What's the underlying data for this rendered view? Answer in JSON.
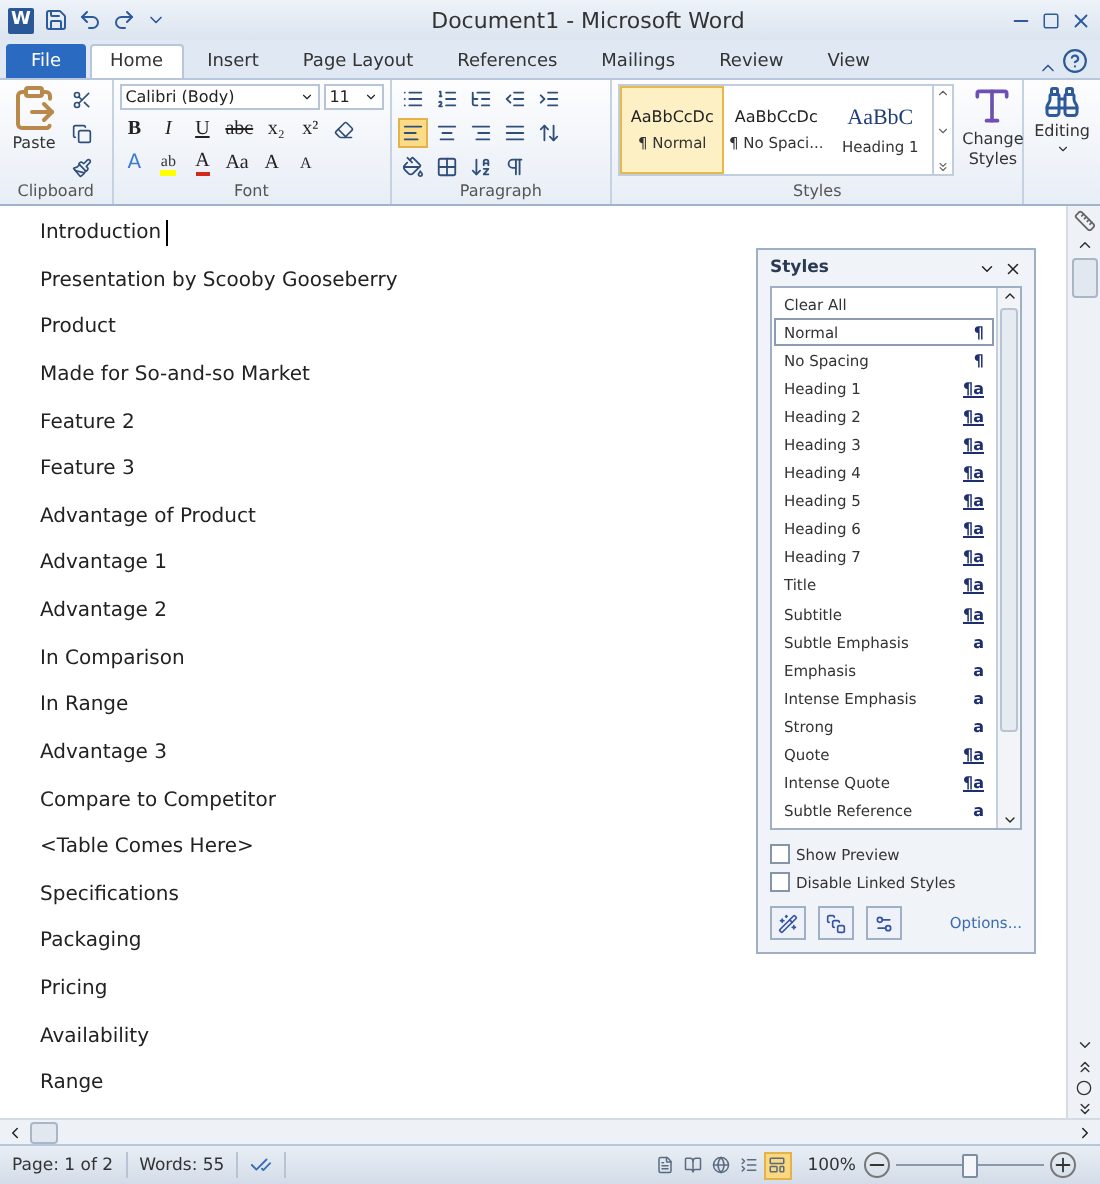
{
  "window": {
    "app_letter": "W",
    "title": "Document1 - Microsoft Word"
  },
  "tabs": [
    {
      "label": "File",
      "kind": "file",
      "selected": false
    },
    {
      "label": "Home",
      "kind": "tab",
      "selected": true
    },
    {
      "label": "Insert",
      "kind": "tab",
      "selected": false
    },
    {
      "label": "Page Layout",
      "kind": "tab",
      "selected": false
    },
    {
      "label": "References",
      "kind": "tab",
      "selected": false
    },
    {
      "label": "Mailings",
      "kind": "tab",
      "selected": false
    },
    {
      "label": "Review",
      "kind": "tab",
      "selected": false
    },
    {
      "label": "View",
      "kind": "tab",
      "selected": false
    }
  ],
  "ribbon": {
    "clipboard": {
      "paste_label": "Paste",
      "group_label": "Clipboard"
    },
    "font": {
      "font_name": "Calibri (Body)",
      "font_size": "11",
      "group_label": "Font",
      "row1": [
        "B",
        "I",
        "U",
        "abc",
        "x₂",
        "x²"
      ],
      "row2": [
        {
          "text": "A",
          "kind": "effects"
        },
        {
          "text": "ab",
          "kind": "highlight"
        },
        {
          "text": "A",
          "kind": "color"
        },
        {
          "text": "Aa",
          "kind": "case"
        },
        {
          "text": "A",
          "kind": "grow"
        },
        {
          "text": "A",
          "kind": "shrink"
        }
      ]
    },
    "paragraph": {
      "group_label": "Paragraph",
      "alignments": [
        {
          "kind": "left",
          "selected": true
        },
        {
          "kind": "center",
          "selected": false
        },
        {
          "kind": "right",
          "selected": false
        },
        {
          "kind": "justify",
          "selected": false
        }
      ]
    },
    "styles": {
      "group_label": "Styles",
      "gallery": [
        {
          "preview": "AaBbCcDc",
          "label": "¶ Normal",
          "kind": "body",
          "selected": true
        },
        {
          "preview": "AaBbCcDc",
          "label": "¶ No Spaci...",
          "kind": "body",
          "selected": false
        },
        {
          "preview": "AaBbC",
          "label": "Heading 1",
          "kind": "heading",
          "selected": false
        }
      ],
      "change_styles": [
        "Change",
        "Styles"
      ]
    },
    "editing": {
      "label": "Editing"
    }
  },
  "document": {
    "lines": [
      {
        "text": "Introduction",
        "cursor": true
      },
      {
        "text": "Presentation by Scooby Gooseberry",
        "cursor": false
      },
      {
        "text": "Product",
        "cursor": false
      },
      {
        "text": "Made for So-and-so Market",
        "cursor": false
      },
      {
        "text": "Feature 2",
        "cursor": false
      },
      {
        "text": "Feature 3",
        "cursor": false
      },
      {
        "text": "Advantage of Product",
        "cursor": false
      },
      {
        "text": "Advantage 1",
        "cursor": false
      },
      {
        "text": "Advantage 2",
        "cursor": false
      },
      {
        "text": "In Comparison",
        "cursor": false
      },
      {
        "text": "In Range",
        "cursor": false
      },
      {
        "text": "Advantage 3",
        "cursor": false
      },
      {
        "text": "Compare to Competitor",
        "cursor": false
      },
      {
        "text": "<Table Comes Here>",
        "cursor": false
      },
      {
        "text": "Specifications",
        "cursor": false
      },
      {
        "text": "Packaging",
        "cursor": false
      },
      {
        "text": "Pricing",
        "cursor": false
      },
      {
        "text": "Availability",
        "cursor": false
      },
      {
        "text": "Range",
        "cursor": false
      }
    ]
  },
  "styles_pane": {
    "title": "Styles",
    "items": [
      {
        "name": "Clear All",
        "kind": "none",
        "selected": false
      },
      {
        "name": "Normal",
        "kind": "para",
        "glyph": "¶",
        "selected": true
      },
      {
        "name": "No Spacing",
        "kind": "para",
        "glyph": "¶",
        "selected": false
      },
      {
        "name": "Heading 1",
        "kind": "linked",
        "glyph": "¶a",
        "selected": false
      },
      {
        "name": "Heading 2",
        "kind": "linked",
        "glyph": "¶a",
        "selected": false
      },
      {
        "name": "Heading 3",
        "kind": "linked",
        "glyph": "¶a",
        "selected": false
      },
      {
        "name": "Heading 4",
        "kind": "linked",
        "glyph": "¶a",
        "selected": false
      },
      {
        "name": "Heading 5",
        "kind": "linked",
        "glyph": "¶a",
        "selected": false
      },
      {
        "name": "Heading 6",
        "kind": "linked",
        "glyph": "¶a",
        "selected": false
      },
      {
        "name": "Heading 7",
        "kind": "linked",
        "glyph": "¶a",
        "selected": false
      },
      {
        "name": "Title",
        "kind": "linked",
        "glyph": "¶a",
        "selected": false
      },
      {
        "name": "Subtitle",
        "kind": "linked",
        "glyph": "¶a",
        "selected": false
      },
      {
        "name": "Subtle Emphasis",
        "kind": "char",
        "glyph": "a",
        "selected": false
      },
      {
        "name": "Emphasis",
        "kind": "char",
        "glyph": "a",
        "selected": false
      },
      {
        "name": "Intense Emphasis",
        "kind": "char",
        "glyph": "a",
        "selected": false
      },
      {
        "name": "Strong",
        "kind": "char",
        "glyph": "a",
        "selected": false
      },
      {
        "name": "Quote",
        "kind": "linked",
        "glyph": "¶a",
        "selected": false
      },
      {
        "name": "Intense Quote",
        "kind": "linked",
        "glyph": "¶a",
        "selected": false
      },
      {
        "name": "Subtle Reference",
        "kind": "char",
        "glyph": "a",
        "selected": false
      }
    ],
    "options": [
      {
        "label": "Show Preview",
        "checked": false
      },
      {
        "label": "Disable Linked Styles",
        "checked": false
      }
    ],
    "options_link": "Options..."
  },
  "status_bar": {
    "page": "Page: 1 of 2",
    "words": "Words: 55",
    "views": [
      {
        "selected": false
      },
      {
        "selected": false
      },
      {
        "selected": false
      },
      {
        "selected": false
      },
      {
        "selected": true
      }
    ],
    "zoom": "100%",
    "zoom_slider": {
      "level": 0.5
    }
  }
}
